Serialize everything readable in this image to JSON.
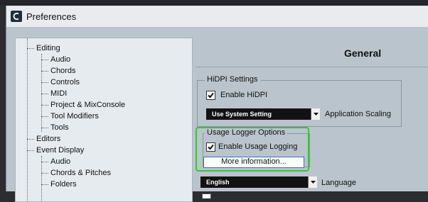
{
  "window": {
    "title": "Preferences"
  },
  "tree": {
    "items": [
      {
        "label": "Editing"
      },
      {
        "label": "Audio"
      },
      {
        "label": "Chords"
      },
      {
        "label": "Controls"
      },
      {
        "label": "MIDI"
      },
      {
        "label": "Project & MixConsole"
      },
      {
        "label": "Tool Modifiers"
      },
      {
        "label": "Tools"
      },
      {
        "label": "Editors"
      },
      {
        "label": "Event Display"
      },
      {
        "label": "Audio"
      },
      {
        "label": "Chords & Pitches"
      },
      {
        "label": "Folders"
      }
    ]
  },
  "panel": {
    "title": "General",
    "hidpi": {
      "group_label": "HiDPI Settings",
      "enable_label": "Enable HiDPI",
      "enable_checked": true,
      "scaling_value": "Use System Setting",
      "scaling_label": "Application Scaling"
    },
    "usage_logger": {
      "group_label": "Usage Logger Options",
      "enable_label": "Enable Usage Logging",
      "enable_checked": true,
      "more_info_button": "More information..."
    },
    "language": {
      "value": "English",
      "label": "Language"
    }
  },
  "colors": {
    "highlight": "#3fbf3f",
    "panel_bg": "#b9c4cc",
    "tree_bg": "#e6ebef"
  }
}
